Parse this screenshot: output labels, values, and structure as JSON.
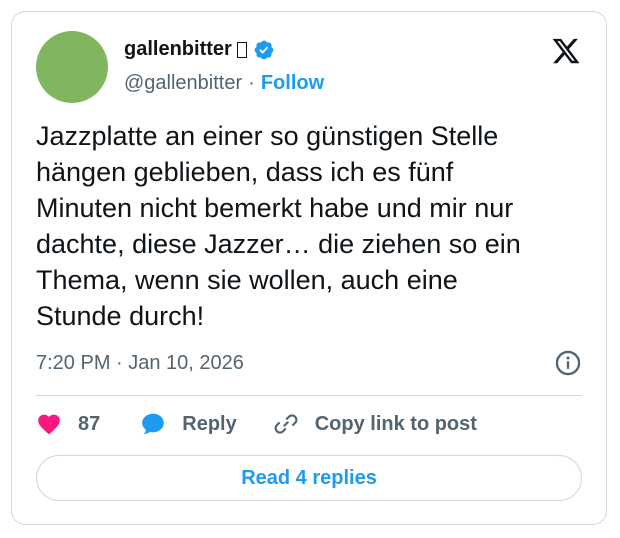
{
  "author": {
    "display_name": "gallenbitter",
    "handle": "@gallenbitter",
    "verified": true,
    "follow_label": "Follow",
    "separator": "·"
  },
  "tweet": {
    "text": "Jazzplatte an einer so günstigen Stelle\nhängen geblieben, dass ich es fünf\nMinuten nicht bemerkt habe und mir nur\ndachte, diese Jazzer… die ziehen so ein\nThema, wenn sie wollen, auch eine\nStunde durch!",
    "timestamp": "7:20 PM · Jan 10, 2026"
  },
  "actions": {
    "like_count": "87",
    "reply_label": "Reply",
    "copy_label": "Copy link to post"
  },
  "read_replies_label": "Read 4 replies",
  "colors": {
    "accent": "#1d9bf0",
    "like": "#f91880",
    "text": "#0f1419",
    "muted": "#536471",
    "border": "#cfd9de",
    "avatar": "#7fb65f"
  },
  "icons": {
    "brand": "x-logo-icon",
    "verified": "verified-badge-icon",
    "info": "info-icon",
    "like": "heart-icon",
    "reply": "speech-bubble-icon",
    "copy": "link-icon"
  }
}
